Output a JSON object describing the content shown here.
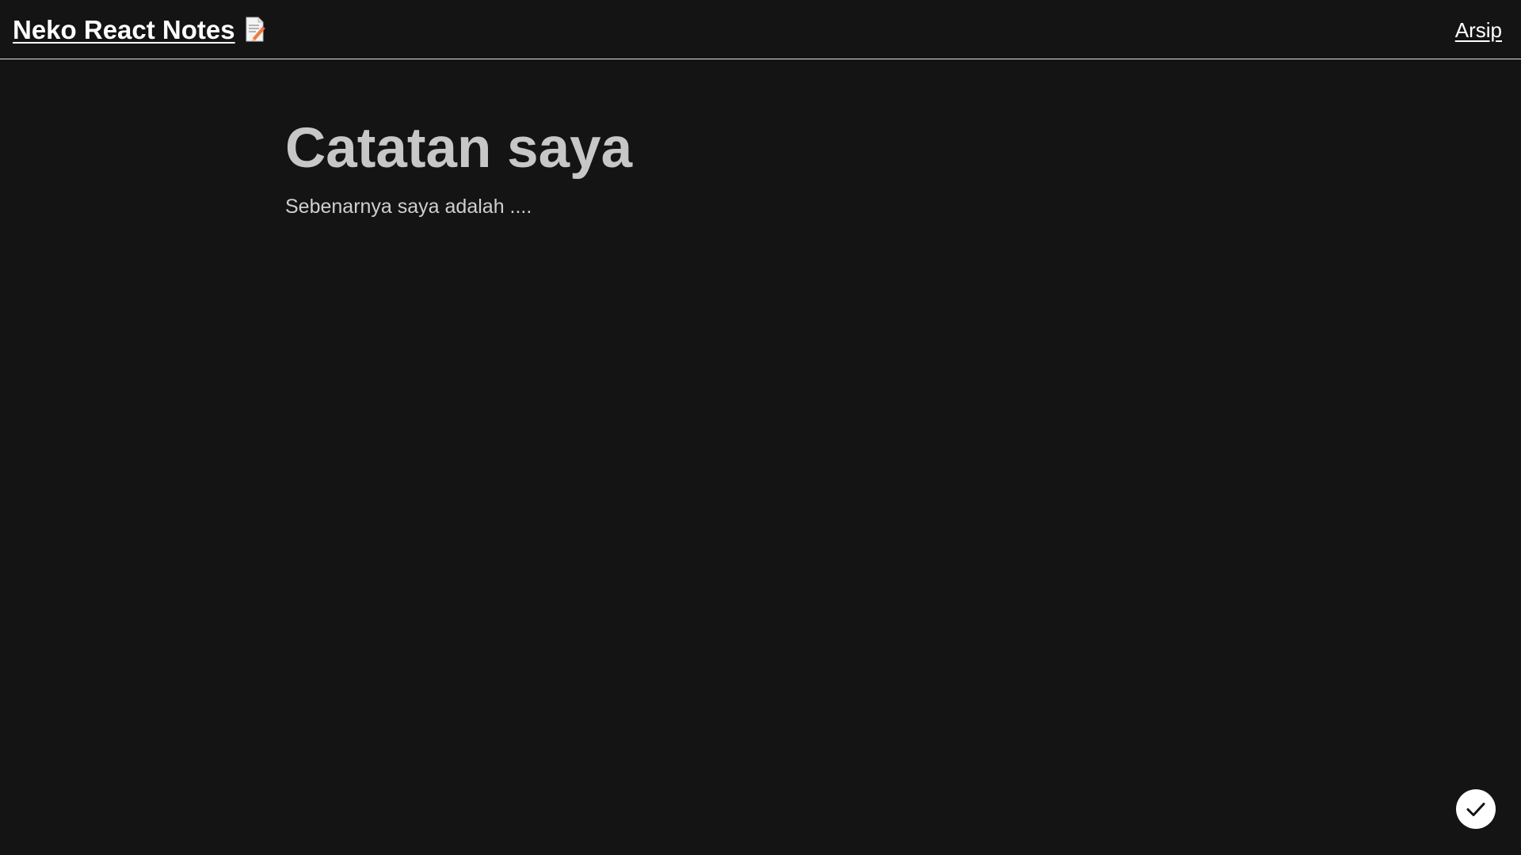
{
  "header": {
    "brand_title": "Neko React Notes",
    "brand_icon": "memo-icon",
    "nav_archive_label": "Arsip"
  },
  "note": {
    "title": "Catatan saya",
    "body": "Sebenarnya saya adalah ...."
  },
  "actions": {
    "save_icon": "checkmark-icon"
  },
  "colors": {
    "background": "#141414",
    "header_border": "#e6e6e6",
    "title_text": "#c7c7c7",
    "body_text": "#cfcfcf",
    "fab_background": "#ffffff",
    "fab_icon": "#141414"
  }
}
